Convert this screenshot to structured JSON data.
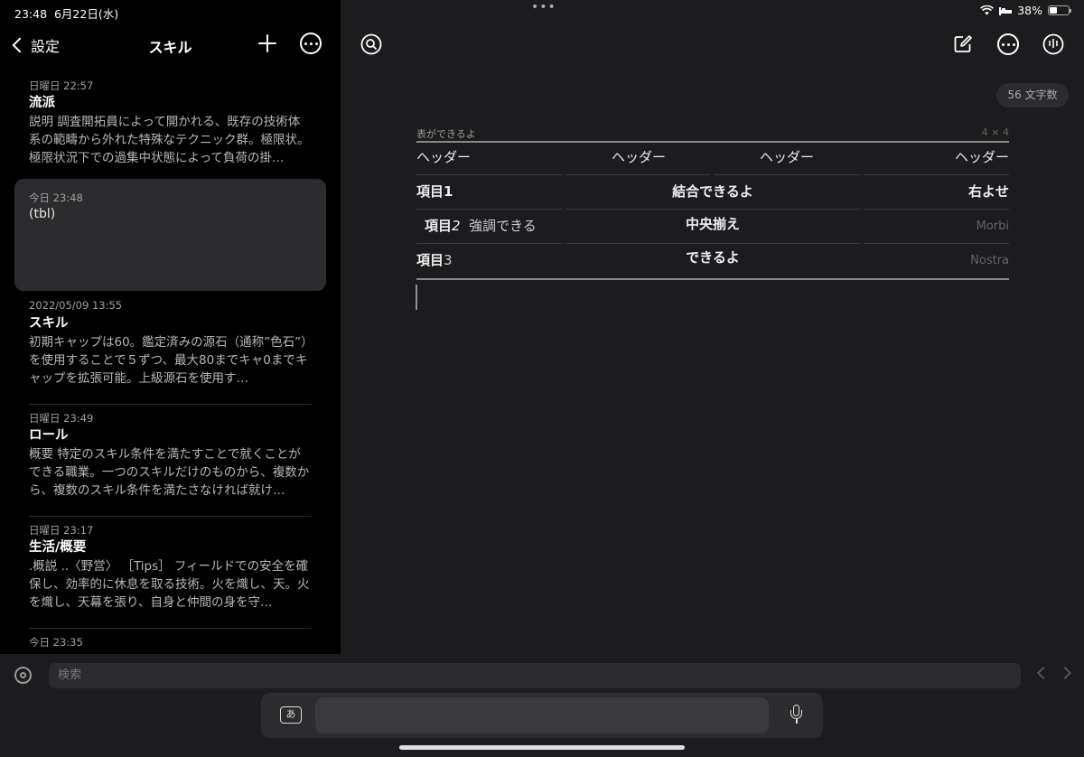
{
  "status": {
    "time": "23:48",
    "date": "6月22日(水)",
    "battery": "38%",
    "battery_level": 0.38
  },
  "sidebar": {
    "back_label": "設定",
    "title": "スキル",
    "notes": [
      {
        "date": "日曜日 22:57",
        "title": "流派",
        "body": "説明 調査開拓員によって開かれる、既存の技術体系の範疇から外れた特殊なテクニック群。極限状。極限状況下での過集中状態によって負荷の掛…"
      },
      {
        "date": "今日 23:48",
        "title": "",
        "body": "(tbl)"
      },
      {
        "date": "2022/05/09 13:55",
        "title": "スキル",
        "body": "初期キャップは60。鑑定済みの源石（通称”色石”）を使用することで５ずつ、最大80までキャ0までキャップを拡張可能。上級源石を使用す…"
      },
      {
        "date": "日曜日 23:49",
        "title": "ロール",
        "body": "概要 特定のスキル条件を満たすことで就くことができる職業。一つのスキルだけのものから、複数から、複数のスキル条件を満たさなければ就け…"
      },
      {
        "date": "日曜日 23:17",
        "title": "生活/概要",
        "body": ".概説 ..〈野営〉 ［Tips］ フィールドでの安全を確保し、効率的に休息を取る技術。火を熾し、天。火を熾し、天幕を張り、自身と仲間の身を守…"
      },
      {
        "date": "今日 23:35",
        "title": "",
        "body": ""
      }
    ]
  },
  "main": {
    "char_count": "56 文字数",
    "table": {
      "caption": "表ができるよ",
      "dimensions": "4 × 4",
      "header": [
        "ヘッダー",
        "ヘッダー",
        "ヘッダー",
        "ヘッダー"
      ],
      "rows": [
        {
          "c1": "項目1",
          "merged": "結合できるよ",
          "c4": "右よせ"
        },
        {
          "c1a": "項目",
          "c1b": "2",
          "c1c": "強調できる",
          "merged": "中央揃え",
          "c4": "Morbi"
        },
        {
          "c1a": "項目",
          "c1b": "3",
          "merged": "できるよ",
          "c4": "Nostra"
        }
      ]
    }
  },
  "keyboard": {
    "search_placeholder": "検索",
    "ime_label": "あ"
  }
}
